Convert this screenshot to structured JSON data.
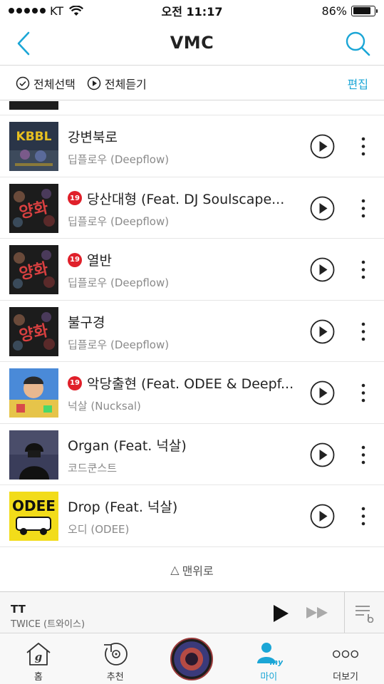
{
  "status_bar": {
    "carrier": "KT",
    "time": "오전 11:17",
    "battery": "86%",
    "battery_level": 0.86
  },
  "nav": {
    "title": "VMC"
  },
  "toolbar": {
    "select_all": "전체선택",
    "play_all": "전체듣기",
    "edit": "편집"
  },
  "songs": [
    {
      "title": "강변북로",
      "artist": "딥플로우 (Deepflow)",
      "explicit": false,
      "art": "kbbl"
    },
    {
      "title": "당산대형 (Feat. DJ Soulscape...",
      "artist": "딥플로우 (Deepflow)",
      "explicit": true,
      "explicit_label": "19",
      "art": "yangwha"
    },
    {
      "title": "열반",
      "artist": "딥플로우 (Deepflow)",
      "explicit": true,
      "explicit_label": "19",
      "art": "yangwha"
    },
    {
      "title": "불구경",
      "artist": "딥플로우 (Deepflow)",
      "explicit": false,
      "art": "yangwha"
    },
    {
      "title": "악당출현 (Feat. ODEE & Deepf...",
      "artist": "넉살 (Nucksal)",
      "explicit": true,
      "explicit_label": "19",
      "art": "nucksal"
    },
    {
      "title": "Organ (Feat. 넉살)",
      "artist": "코드쿤스트",
      "explicit": false,
      "art": "organ"
    },
    {
      "title": "Drop (Feat. 넉살)",
      "artist": "오디 (ODEE)",
      "explicit": false,
      "art": "odee"
    }
  ],
  "scroll_top": {
    "label": "맨위로"
  },
  "player": {
    "title": "TT",
    "artist": "TWICE (트와이스)"
  },
  "tabs": [
    {
      "label": "홈",
      "icon": "home-icon"
    },
    {
      "label": "추천",
      "icon": "recommend-icon"
    },
    {
      "label": "",
      "icon": "now-playing-disc-icon"
    },
    {
      "label": "마이",
      "icon": "my-icon",
      "active": true
    },
    {
      "label": "더보기",
      "icon": "more-icon"
    }
  ],
  "colors": {
    "accent": "#1ba6d6",
    "explicit_badge": "#e0202a"
  }
}
